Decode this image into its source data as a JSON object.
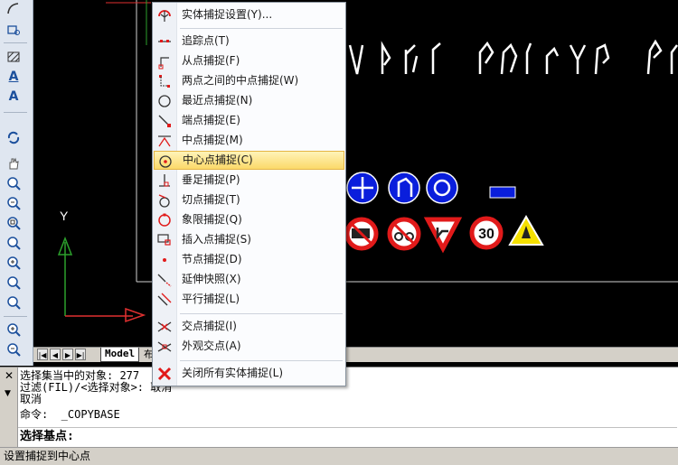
{
  "menu": {
    "items": [
      {
        "label": "实体捕捉设置(Y)...",
        "icon": "snap-settings-icon"
      },
      {
        "label": "追踪点(T)",
        "icon": "tracking-icon"
      },
      {
        "label": "从点捕捉(F)",
        "icon": "from-point-icon"
      },
      {
        "label": "两点之间的中点捕捉(W)",
        "icon": "mid-between-points-icon"
      },
      {
        "label": "最近点捕捉(N)",
        "icon": "nearest-icon"
      },
      {
        "label": "端点捕捉(E)",
        "icon": "endpoint-icon"
      },
      {
        "label": "中点捕捉(M)",
        "icon": "midpoint-icon"
      },
      {
        "label": "中心点捕捉(C)",
        "icon": "center-icon"
      },
      {
        "label": "垂足捕捉(P)",
        "icon": "perpendicular-icon"
      },
      {
        "label": "切点捕捉(T)",
        "icon": "tangent-icon"
      },
      {
        "label": "象限捕捉(Q)",
        "icon": "quadrant-icon"
      },
      {
        "label": "插入点捕捉(S)",
        "icon": "insertion-icon"
      },
      {
        "label": "节点捕捉(D)",
        "icon": "node-icon"
      },
      {
        "label": "延伸快照(X)",
        "icon": "extension-icon"
      },
      {
        "label": "平行捕捉(L)",
        "icon": "parallel-icon"
      },
      {
        "label": "交点捕捉(I)",
        "icon": "intersection-icon"
      },
      {
        "label": "外观交点(A)",
        "icon": "apparent-intersection-icon"
      },
      {
        "label": "关闭所有实体捕捉(L)",
        "icon": "snap-off-icon"
      }
    ]
  },
  "tabs": {
    "model": "Model",
    "layout_partial": "布"
  },
  "axis": {
    "y_label": "Y"
  },
  "sign_text": "30",
  "command": {
    "lines": [
      "选择集当中的对象: 277",
      "过滤(FIL)/<选择对象>: 取消",
      "取消",
      "命令:  _COPYBASE"
    ],
    "prompt": "选择基点:"
  },
  "status": "设置捕捉到中心点",
  "colors": {
    "accent_blue": "#1b4f9c",
    "sign_blue": "#0a1edc",
    "sign_red": "#e11a1a",
    "highlight": "#fbd96a"
  }
}
